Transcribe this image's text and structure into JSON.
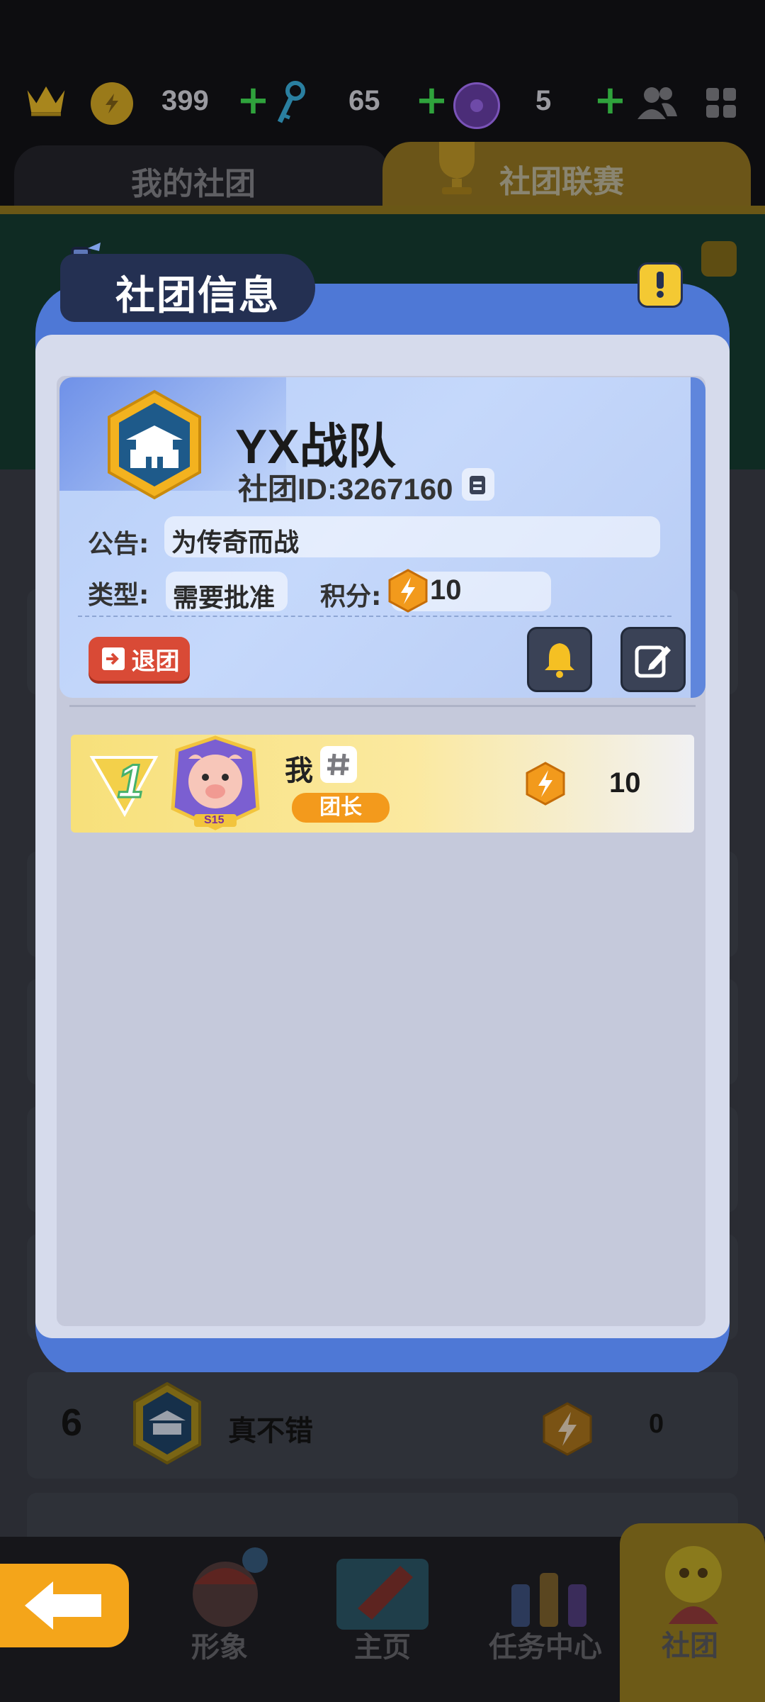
{
  "topbar": {
    "coins": "399",
    "keys": "65",
    "tokens": "5"
  },
  "tabs": {
    "my_club": "我的社团",
    "league": "社团联赛"
  },
  "modal": {
    "title": "社团信息"
  },
  "club": {
    "name": "YX战队",
    "id_text": "社团ID:3267160",
    "notice_label": "公告:",
    "notice_value": "为传奇而战",
    "type_label": "类型:",
    "type_value": "需要批准",
    "points_label": "积分:",
    "points_value": "10",
    "quit_label": "退团"
  },
  "members": [
    {
      "rank": "1",
      "name": "我",
      "role": "团长",
      "score": "10",
      "season_badge": "S15"
    }
  ],
  "background_list": {
    "row_rank": "6",
    "row_name": "真不错",
    "row_score": "0"
  },
  "nav": {
    "items": [
      {
        "label": "形象"
      },
      {
        "label": "主页"
      },
      {
        "label": "任务中心"
      },
      {
        "label": "社团"
      }
    ]
  },
  "colors": {
    "modal_blue": "#4e78d6",
    "accent_orange": "#f39a1c",
    "quit_red": "#d94a36",
    "help_yellow": "#f4c933"
  }
}
